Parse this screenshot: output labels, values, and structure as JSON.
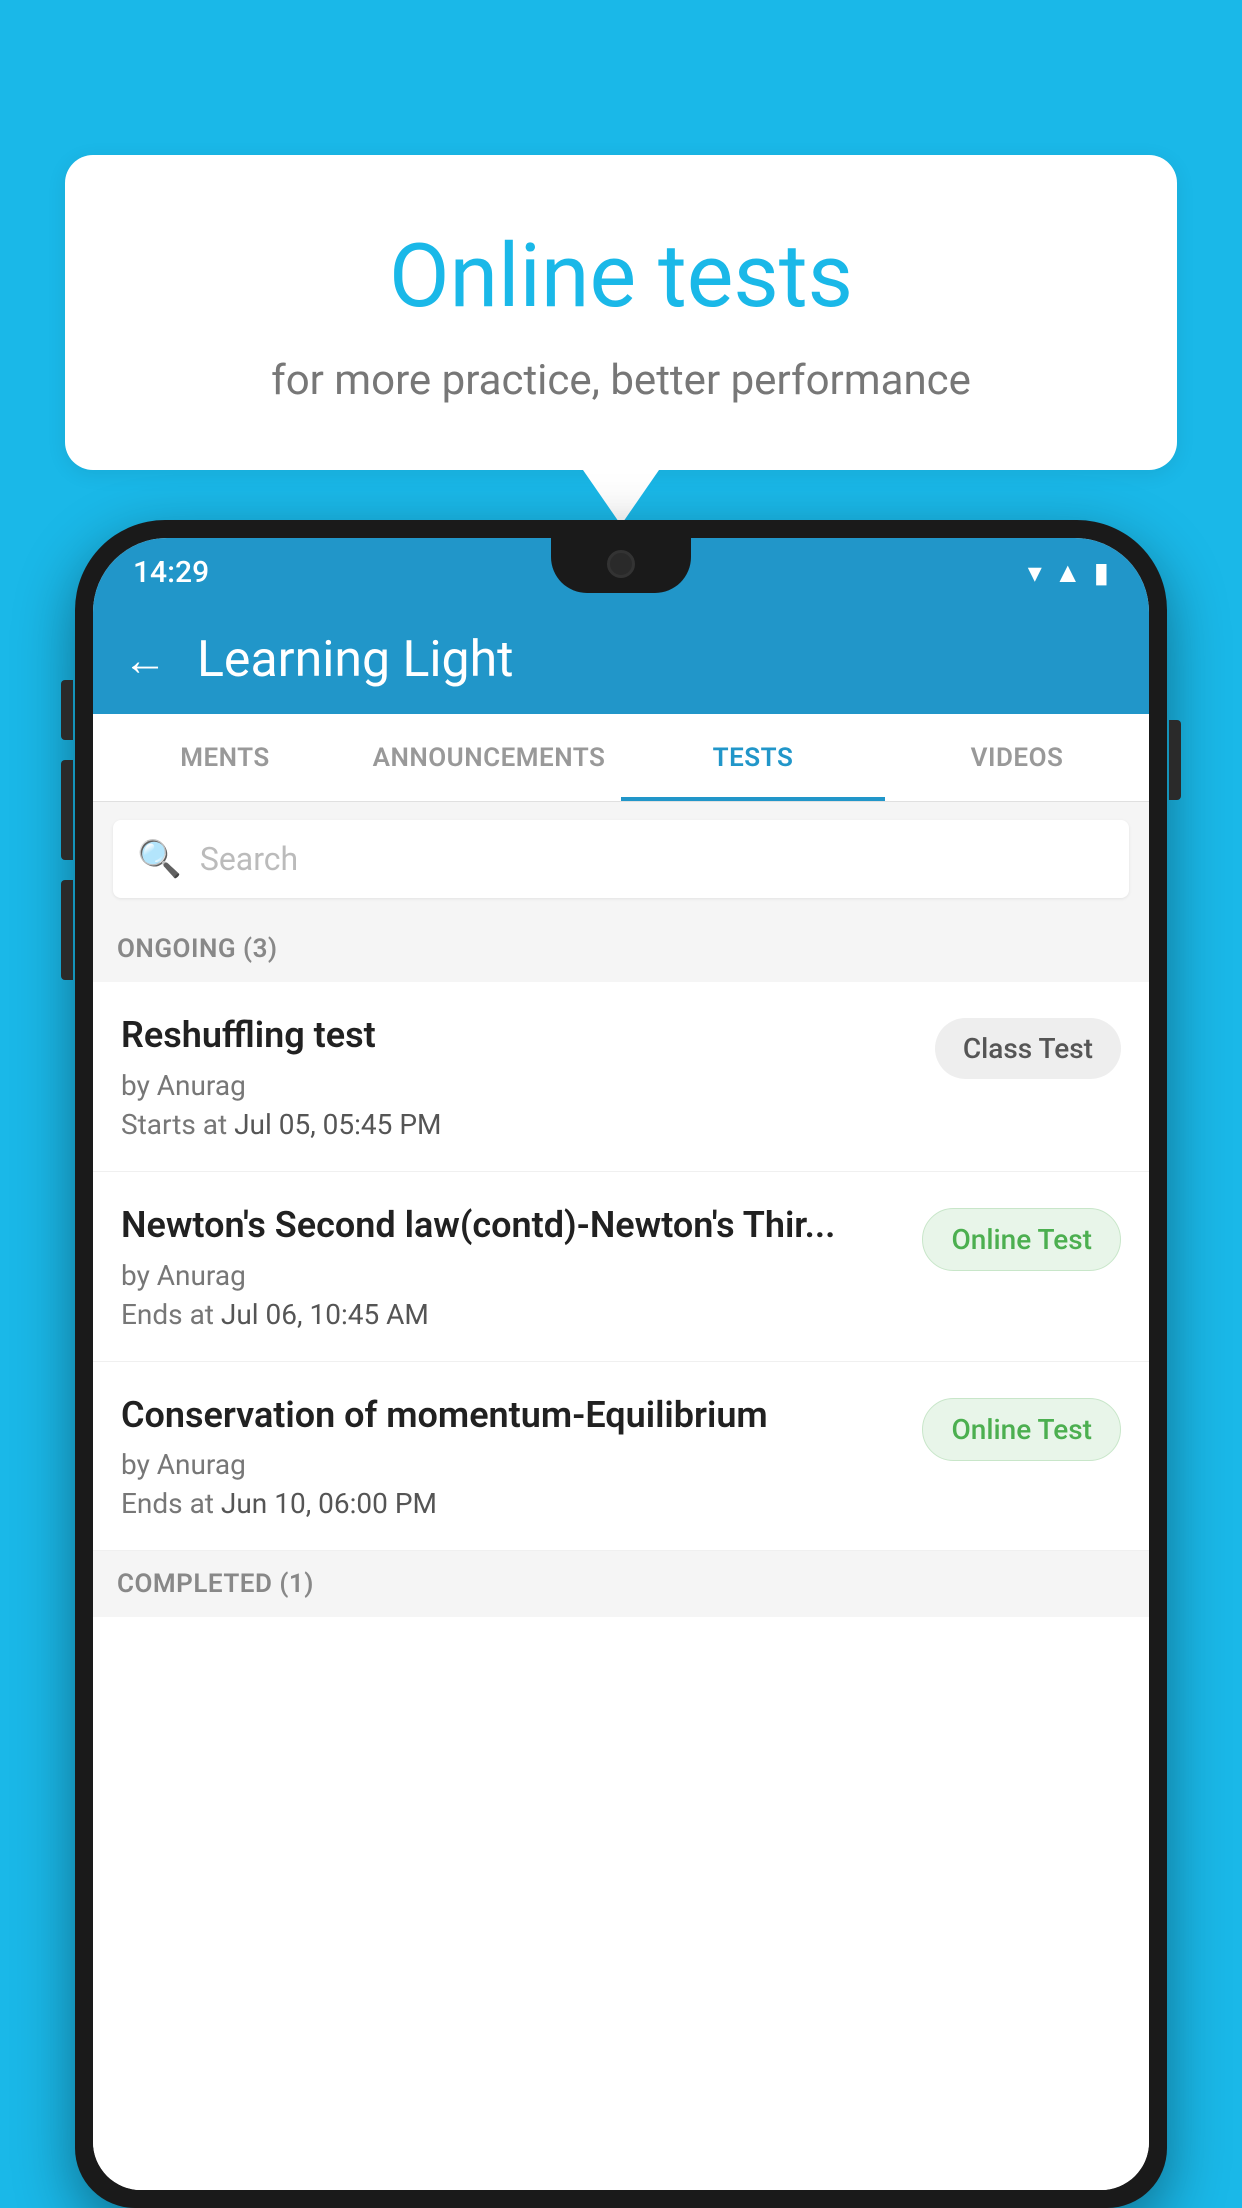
{
  "background_color": "#1ab8e8",
  "speech_bubble": {
    "title": "Online tests",
    "subtitle": "for more practice, better performance"
  },
  "phone": {
    "status_bar": {
      "time": "14:29",
      "icons": [
        "wifi",
        "signal",
        "battery"
      ]
    },
    "app_bar": {
      "title": "Learning Light",
      "back_label": "←"
    },
    "tabs": [
      {
        "label": "MENTS",
        "active": false
      },
      {
        "label": "ANNOUNCEMENTS",
        "active": false
      },
      {
        "label": "TESTS",
        "active": true
      },
      {
        "label": "VIDEOS",
        "active": false
      }
    ],
    "search": {
      "placeholder": "Search"
    },
    "ongoing_section": {
      "title": "ONGOING (3)"
    },
    "test_items": [
      {
        "name": "Reshuffling test",
        "author": "by Anurag",
        "date_label": "Starts at",
        "date": "Jul 05, 05:45 PM",
        "badge": "Class Test",
        "badge_type": "class"
      },
      {
        "name": "Newton's Second law(contd)-Newton's Thir...",
        "author": "by Anurag",
        "date_label": "Ends at",
        "date": "Jul 06, 10:45 AM",
        "badge": "Online Test",
        "badge_type": "online"
      },
      {
        "name": "Conservation of momentum-Equilibrium",
        "author": "by Anurag",
        "date_label": "Ends at",
        "date": "Jun 10, 06:00 PM",
        "badge": "Online Test",
        "badge_type": "online"
      }
    ],
    "completed_section": {
      "title": "COMPLETED (1)"
    }
  }
}
